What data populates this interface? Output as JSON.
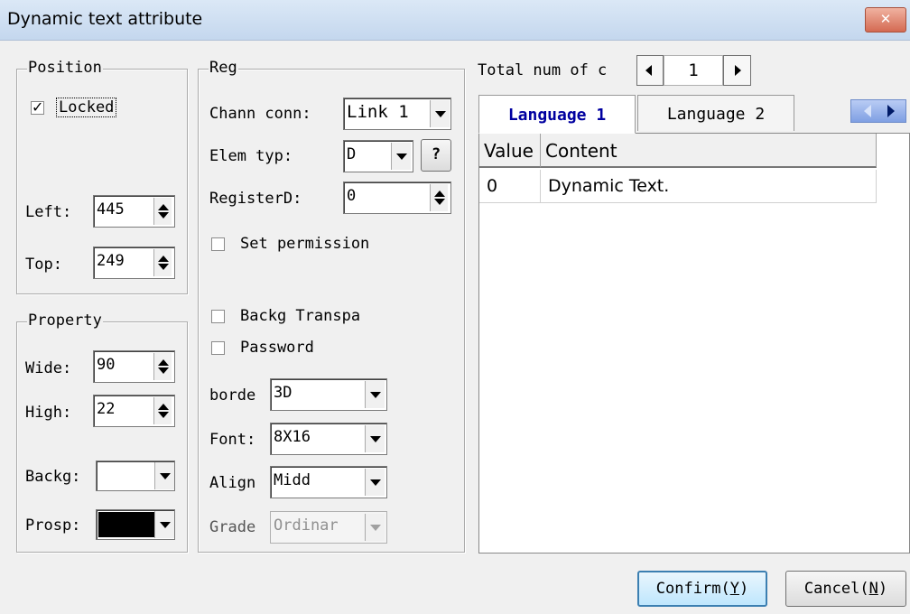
{
  "window": {
    "title": "Dynamic text attribute",
    "close_glyph": "✕"
  },
  "position": {
    "legend": "Position",
    "locked_label": "Locked",
    "locked_checked": true,
    "check_glyph": "✓",
    "left_label": "Left:",
    "left_value": "445",
    "top_label": "Top:",
    "top_value": "249"
  },
  "property": {
    "legend": "Property",
    "wide_label": "Wide:",
    "wide_value": "90",
    "high_label": "High:",
    "high_value": "22",
    "backg_label": "Backg:",
    "backg_color": "#ffffff",
    "prosp_label": "Prosp:",
    "prosp_color": "#000000"
  },
  "reg": {
    "legend": "Reg",
    "chann_label": "Chann conn:",
    "chann_value": "Link 1",
    "elem_label": "Elem typ:",
    "elem_value": "D",
    "help_label": "?",
    "register_label": "RegisterD:",
    "register_value": "0",
    "permission_label": "Set permission",
    "permission_checked": false,
    "backg_transpa_label": "Backg Transpa",
    "backg_transpa_checked": false,
    "password_label": "Password",
    "password_checked": false,
    "border_label": "borde",
    "border_value": "3D",
    "font_label": "Font:",
    "font_value": "8X16",
    "align_label": "Align",
    "align_value": "Midd",
    "grade_label": "Grade",
    "grade_value": "Ordinar"
  },
  "languages": {
    "total_label": "Total num of c",
    "total_value": "1",
    "tabs": [
      {
        "label": "Language 1",
        "active": true
      },
      {
        "label": "Language 2",
        "active": false
      }
    ],
    "columns": [
      "Value",
      "Content"
    ],
    "rows": [
      [
        "0",
        "Dynamic Text."
      ]
    ]
  },
  "buttons": {
    "confirm": "Confirm",
    "confirm_key": "Y",
    "cancel": "Cancel",
    "cancel_key": "N"
  }
}
